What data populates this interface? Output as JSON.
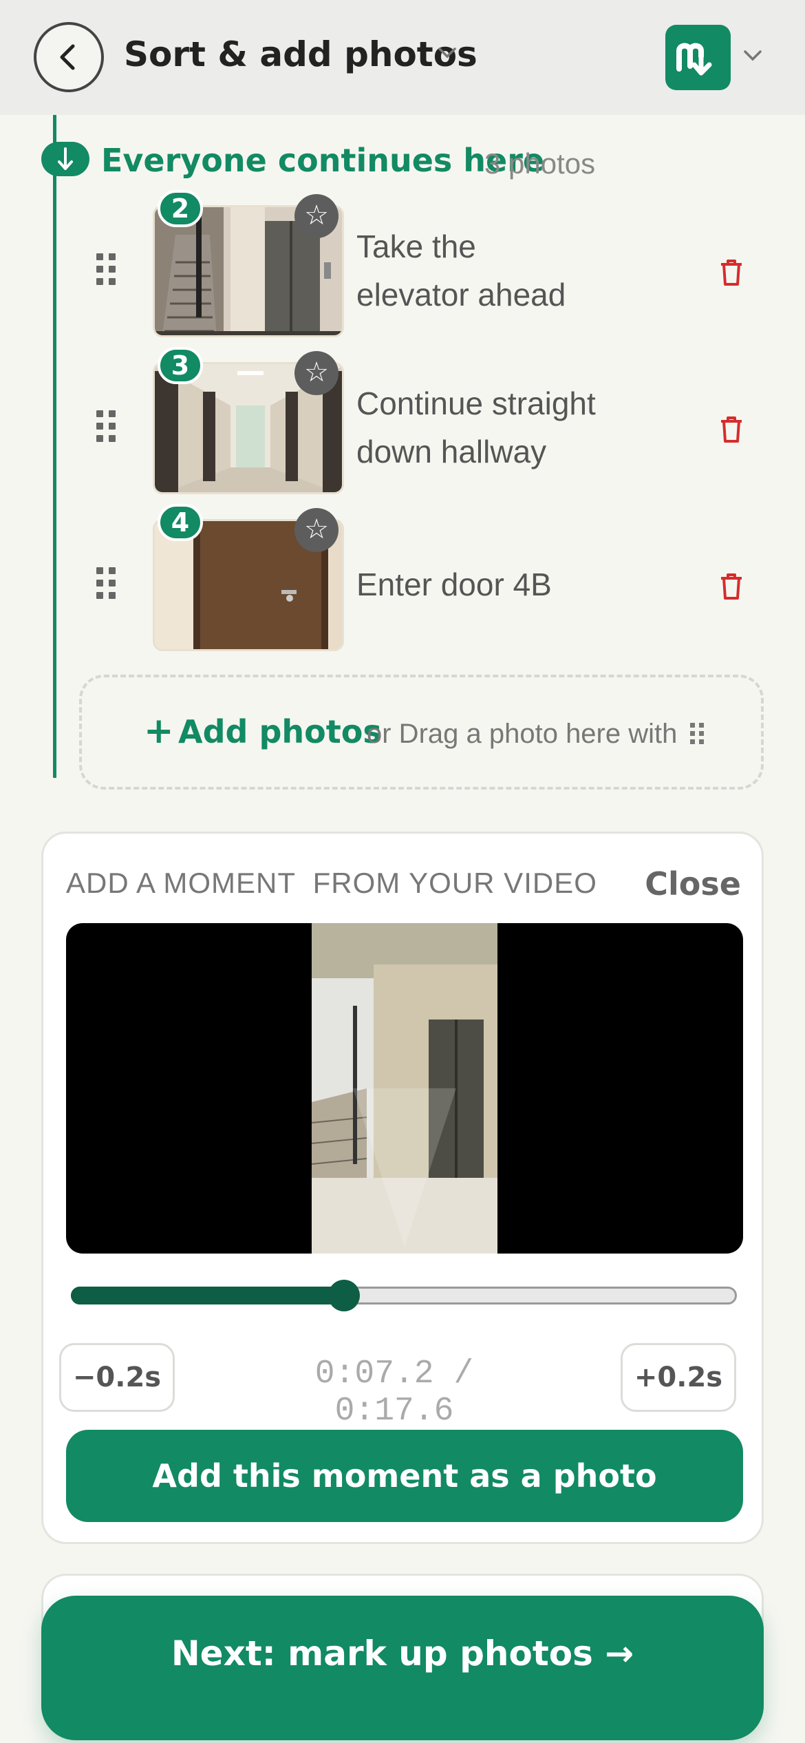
{
  "header": {
    "title": "Sort & add photos",
    "back_icon": "chevron-left-icon",
    "title_dropdown_icon": "chevron-down-icon",
    "logo_icon": "app-logo-icon",
    "account_dropdown_icon": "chevron-down-icon"
  },
  "section": {
    "title": "Everyone continues here",
    "count": "3 photos",
    "marker_icon": "arrow-down-icon"
  },
  "photos": [
    {
      "step": "2",
      "caption_line1": "Take the",
      "caption_line2": "elevator ahead",
      "thumbnail": "stairwell and elevator"
    },
    {
      "step": "3",
      "caption_line1": "Continue straight",
      "caption_line2": "down hallway",
      "thumbnail": "hallway"
    },
    {
      "step": "4",
      "caption_line1": "Enter door 4B",
      "caption_line2": "",
      "thumbnail": "brown door"
    }
  ],
  "add_photos": {
    "plus": "+",
    "label": "Add photos",
    "hint": "or Drag a photo here with",
    "grip_icon": "drag-grip-icon"
  },
  "moment": {
    "heading": "ADD A MOMENT  FROM YOUR VIDEO",
    "close_label": "Close",
    "progress": 0.41,
    "back_step": "−0.2s",
    "forward_step": "+0.2s",
    "time": "0:07.2 / 0:17.6",
    "add_button": "Add this moment as a photo"
  },
  "next_button": "Next: mark up photos →",
  "colors": {
    "brand": "#128a63",
    "brand_dark": "#0d5e44",
    "delete": "#d62c2c",
    "background": "#f6f6f1"
  }
}
